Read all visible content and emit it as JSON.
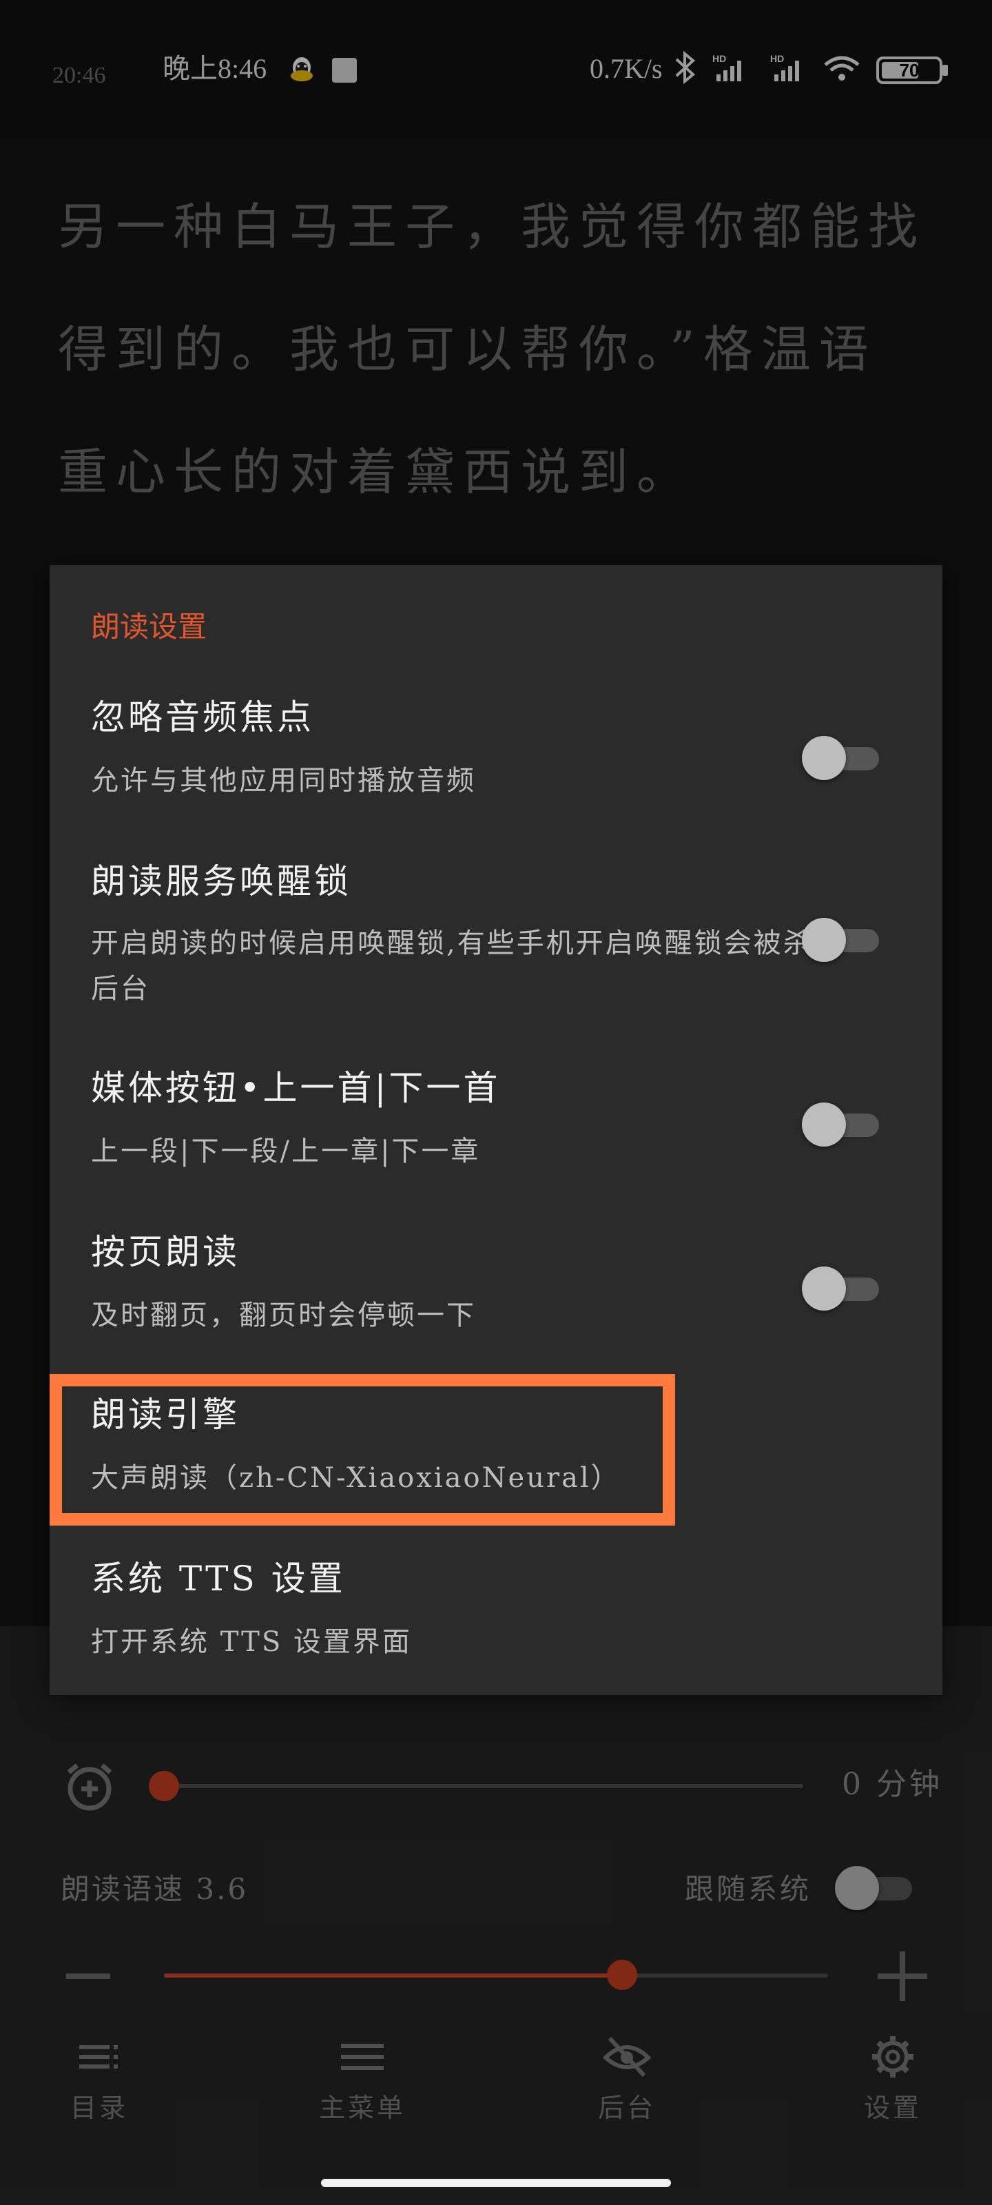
{
  "status_bar": {
    "time_small": "20:46",
    "time": "晚上8:46",
    "speed": "0.7K/s",
    "battery": "70"
  },
  "reader": {
    "text": "另一种白马王子，我觉得你都能找\n得到的。我也可以帮你。”格温语\n重心长的对着黛西说到。"
  },
  "dialog": {
    "title": "朗读设置",
    "items": [
      {
        "title": "忽略音频焦点",
        "summary": "允许与其他应用同时播放音频",
        "toggle": false
      },
      {
        "title": "朗读服务唤醒锁",
        "summary": "开启朗读的时候启用唤醒锁,有些手机开启唤醒锁会被杀后台",
        "toggle": false
      },
      {
        "title": "媒体按钮•上一首|下一首",
        "summary": "上一段|下一段/上一章|下一章",
        "toggle": false
      },
      {
        "title": "按页朗读",
        "summary": "及时翻页，翻页时会停顿一下",
        "toggle": false
      },
      {
        "title": "朗读引擎",
        "summary": "大声朗读（zh-CN-XiaoxiaoNeural）"
      },
      {
        "title": "系统 TTS 设置",
        "summary": "打开系统 TTS 设置界面"
      }
    ]
  },
  "controls": {
    "timer_value": "0 分钟",
    "timer_fraction": 0.0,
    "speed_label": "朗读语速 3.6",
    "speed_fraction": 0.69,
    "follow_label": "跟随系统",
    "follow_toggle": false
  },
  "bottom_nav": [
    {
      "label": "目录",
      "icon": "list-icon"
    },
    {
      "label": "主菜单",
      "icon": "menu-icon"
    },
    {
      "label": "后台",
      "icon": "eye-off-icon"
    },
    {
      "label": "设置",
      "icon": "gear-icon"
    }
  ],
  "colors": {
    "accent": "#e0572e",
    "highlight": "#ff7a3d",
    "dialog_bg": "#2b2b2c"
  }
}
